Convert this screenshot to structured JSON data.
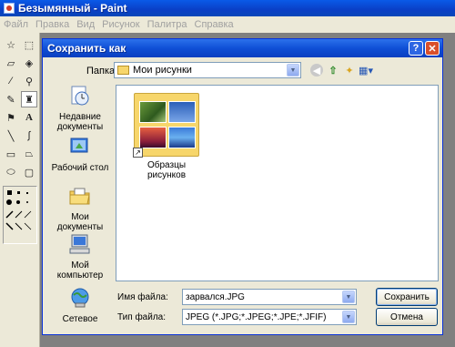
{
  "window": {
    "title": "Безымянный - Paint"
  },
  "menubar": {
    "items": [
      "Файл",
      "Правка",
      "Вид",
      "Рисунок",
      "Палитра",
      "Справка"
    ]
  },
  "toolbox": {
    "tools": [
      "free-select",
      "rect-select",
      "eraser",
      "fill",
      "color-picker",
      "magnifier",
      "pencil",
      "brush",
      "airbrush",
      "text",
      "line",
      "curve",
      "rectangle",
      "polygon",
      "ellipse",
      "rounded-rectangle"
    ],
    "selected": "brush"
  },
  "dialog": {
    "title": "Сохранить как",
    "help_label": "?",
    "close_label": "✕",
    "lookin_label": "Папка:",
    "lookin_value": "Мои рисунки",
    "places": [
      {
        "label": "Недавние документы",
        "icon": "recent-documents-icon"
      },
      {
        "label": "Рабочий стол",
        "icon": "desktop-icon"
      },
      {
        "label": "Мои документы",
        "icon": "my-documents-icon"
      },
      {
        "label": "Мой компьютер",
        "icon": "my-computer-icon"
      },
      {
        "label": "Сетевое",
        "icon": "network-icon"
      }
    ],
    "files": [
      {
        "name": "Образцы рисунков",
        "type": "folder-shortcut"
      }
    ],
    "filename_label": "Имя файла:",
    "filename_value": "зарвался.JPG",
    "filetype_label": "Тип файла:",
    "filetype_value": "JPEG (*.JPG;*.JPEG;*.JPE;*.JFIF)",
    "save_label": "Сохранить",
    "cancel_label": "Отмена"
  }
}
